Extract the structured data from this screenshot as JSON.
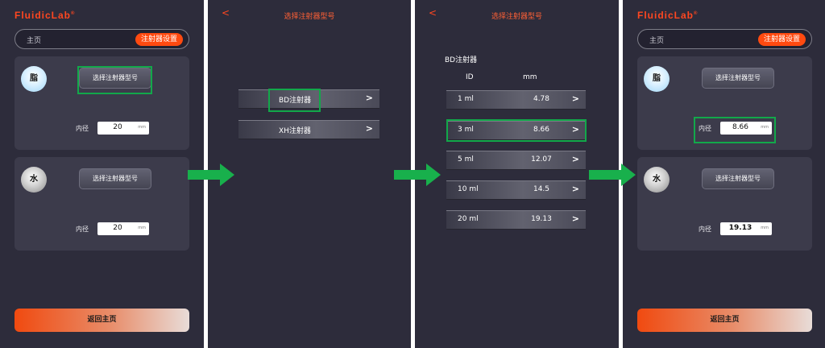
{
  "colors": {
    "accent": "#ff4a10",
    "panel_bg": "#2d2c3b",
    "highlight": "#12a84a",
    "arrow": "#18b04c"
  },
  "screen1": {
    "logo": "FluidicLab",
    "nav": {
      "home": "主页",
      "settings": "注射器设置"
    },
    "cards": [
      {
        "badge": "脂",
        "select_label": "选择注射器型号",
        "diameter_label": "内径",
        "diameter_value": "20",
        "unit": "mm"
      },
      {
        "badge": "水",
        "select_label": "选择注射器型号",
        "diameter_label": "内径",
        "diameter_value": "20",
        "unit": "mm"
      }
    ],
    "back_label": "返回主页"
  },
  "screen2": {
    "back_icon": "<",
    "title": "选择注射器型号",
    "items": [
      {
        "label": "BD注射器",
        "chevron": ">"
      },
      {
        "label": "XH注射器",
        "chevron": ">"
      }
    ]
  },
  "screen3": {
    "back_icon": "<",
    "title": "选择注射器型号",
    "section_title": "BD注射器",
    "header": {
      "id": "ID",
      "mm": "mm"
    },
    "rows": [
      {
        "id": "1 ml",
        "mm": "4.78",
        "chevron": ">"
      },
      {
        "id": "3 ml",
        "mm": "8.66",
        "chevron": ">"
      },
      {
        "id": "5 ml",
        "mm": "12.07",
        "chevron": ">"
      },
      {
        "id": "10 ml",
        "mm": "14.5",
        "chevron": ">"
      },
      {
        "id": "20 ml",
        "mm": "19.13",
        "chevron": ">"
      }
    ]
  },
  "screen4": {
    "logo": "FluidicLab",
    "nav": {
      "home": "主页",
      "settings": "注射器设置"
    },
    "cards": [
      {
        "badge": "脂",
        "select_label": "选择注射器型号",
        "diameter_label": "内径",
        "diameter_value": "8.66",
        "unit": "mm"
      },
      {
        "badge": "水",
        "select_label": "选择注射器型号",
        "diameter_label": "内径",
        "diameter_value": "19.13",
        "unit": "mm"
      }
    ],
    "back_label": "返回主页"
  }
}
